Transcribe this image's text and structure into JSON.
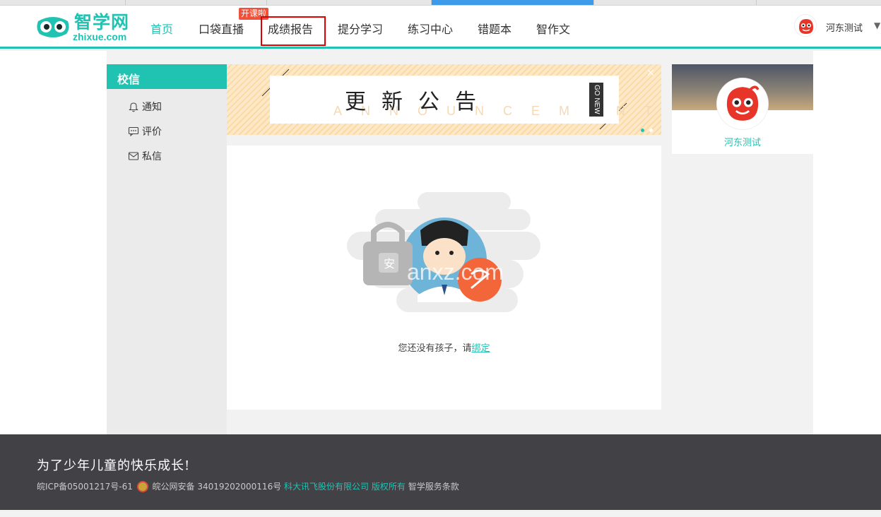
{
  "logo": {
    "cn": "智学网",
    "en": "zhixue.com"
  },
  "nav": {
    "items": [
      {
        "label": "首页"
      },
      {
        "label": "口袋直播"
      },
      {
        "label": "成绩报告"
      },
      {
        "label": "提分学习"
      },
      {
        "label": "练习中心"
      },
      {
        "label": "错题本"
      },
      {
        "label": "智作文"
      }
    ],
    "badge": "开课啦"
  },
  "user": {
    "name": "河东测试",
    "caret": "▼"
  },
  "sidebar": {
    "title": "校信",
    "items": [
      {
        "label": "通知",
        "icon": "bell-icon"
      },
      {
        "label": "评价",
        "icon": "comment-icon"
      },
      {
        "label": "私信",
        "icon": "mail-icon"
      }
    ]
  },
  "banner": {
    "title": "更新公告",
    "subtitle": "ANNOUNCEMENT",
    "tag": "GO NEW",
    "close": "×"
  },
  "empty": {
    "text": "您还没有孩子，请",
    "link": "绑定",
    "watermark": "anxz.com"
  },
  "profile": {
    "name": "河东测试"
  },
  "footer": {
    "slogan": "为了少年儿童的快乐成长!",
    "icp": "皖ICP备05001217号-61",
    "police": "皖公网安备 34019202000116号",
    "company": "科大讯飞股份有限公司 版权所有",
    "terms": "智学服务条款"
  },
  "colors": {
    "brand": "#20c3b2",
    "badge": "#f0513a",
    "footer_bg": "#414146"
  }
}
